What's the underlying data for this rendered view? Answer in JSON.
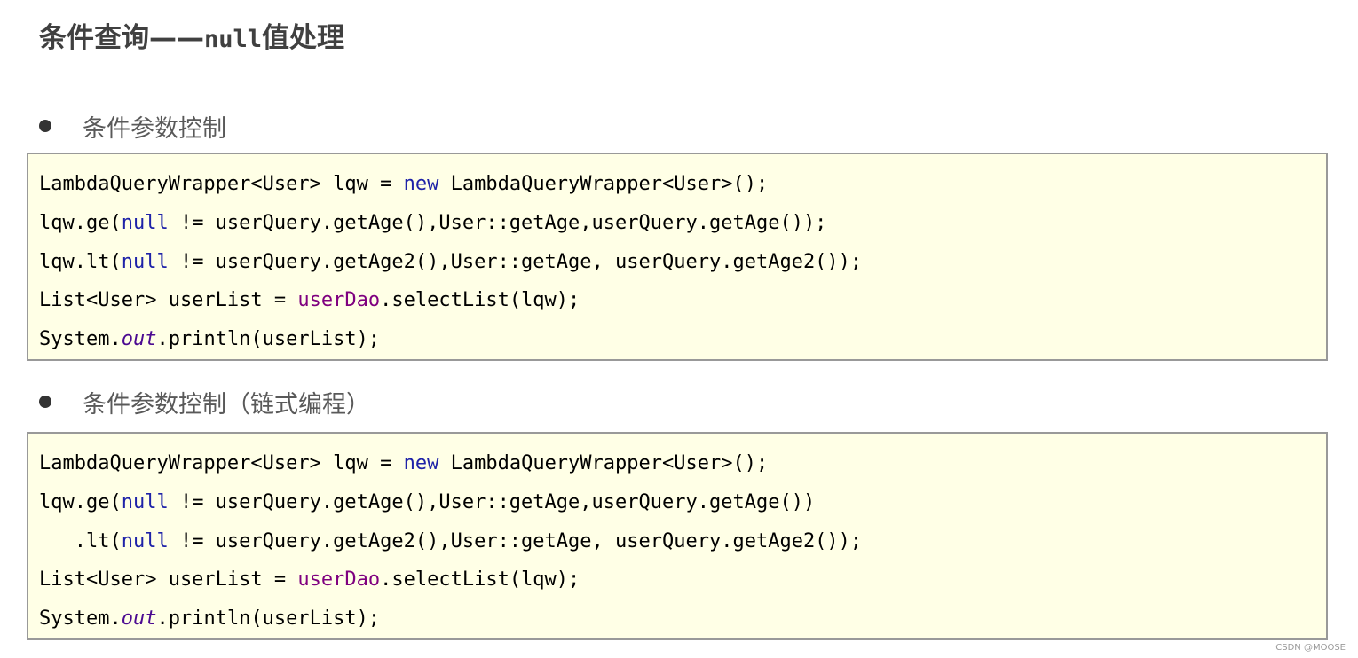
{
  "title": {
    "prefix": "条件查询",
    "dash": "——",
    "code": "null",
    "suffix": "值处理"
  },
  "sections": [
    {
      "heading": "条件参数控制",
      "code_lines": [
        [
          {
            "t": "LambdaQueryWrapper<User> lqw = "
          },
          {
            "t": "new",
            "c": "kw"
          },
          {
            "t": " LambdaQueryWrapper<User>();"
          }
        ],
        [
          {
            "t": "lqw.ge("
          },
          {
            "t": "null",
            "c": "kw"
          },
          {
            "t": " != userQuery.getAge(),User::getAge,userQuery.getAge());"
          }
        ],
        [
          {
            "t": "lqw.lt("
          },
          {
            "t": "null",
            "c": "kw"
          },
          {
            "t": " != userQuery.getAge2(),User::getAge, userQuery.getAge2());"
          }
        ],
        [
          {
            "t": "List<User> userList = "
          },
          {
            "t": "userDao",
            "c": "field"
          },
          {
            "t": ".selectList(lqw);"
          }
        ],
        [
          {
            "t": "System."
          },
          {
            "t": "out",
            "c": "static-field"
          },
          {
            "t": ".println(userList);"
          }
        ]
      ]
    },
    {
      "heading": "条件参数控制（链式编程）",
      "code_lines": [
        [
          {
            "t": "LambdaQueryWrapper<User> lqw = "
          },
          {
            "t": "new",
            "c": "kw"
          },
          {
            "t": " LambdaQueryWrapper<User>();"
          }
        ],
        [
          {
            "t": "lqw.ge("
          },
          {
            "t": "null",
            "c": "kw"
          },
          {
            "t": " != userQuery.getAge(),User::getAge,userQuery.getAge())"
          }
        ],
        [
          {
            "t": "   .lt("
          },
          {
            "t": "null",
            "c": "kw"
          },
          {
            "t": " != userQuery.getAge2(),User::getAge, userQuery.getAge2());"
          }
        ],
        [
          {
            "t": "List<User> userList = "
          },
          {
            "t": "userDao",
            "c": "field"
          },
          {
            "t": ".selectList(lqw);"
          }
        ],
        [
          {
            "t": "System."
          },
          {
            "t": "out",
            "c": "static-field"
          },
          {
            "t": ".println(userList);"
          }
        ]
      ]
    }
  ],
  "watermark": "CSDN @MOOSE"
}
